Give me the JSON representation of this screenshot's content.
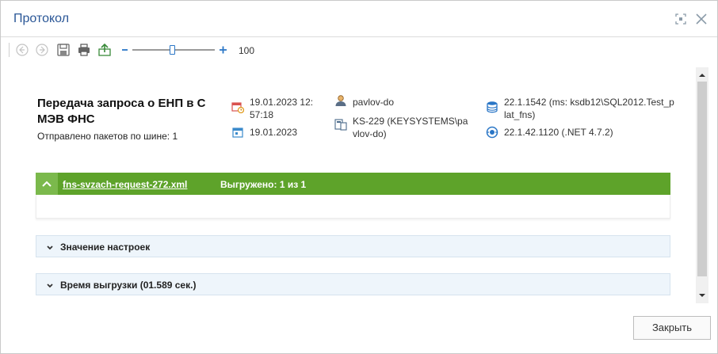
{
  "window": {
    "title": "Протокол"
  },
  "toolbar": {
    "zoom_value": "100",
    "zoom_level_fraction": 0.5
  },
  "header": {
    "title": "Передача запроса о ЕНП в С МЭВ ФНС",
    "subtitle": "Отправлено пакетов по шине: 1",
    "datetime_start": "19.01.2023 12:57:18",
    "date_end": "19.01.2023",
    "user": "pavlov-do",
    "machine": "KS-229 (KEYSYSTEMS\\pavlov-do)",
    "db": "22.1.1542 (ms: ksdb12\\SQL2012.Test_plat_fns)",
    "runtime": "22.1.42.1120 (.NET 4.7.2)"
  },
  "export_block": {
    "file": "fns-svzach-request-272.xml",
    "status": "Выгружено: 1 из 1"
  },
  "sections": [
    {
      "label": "Значение настроек"
    },
    {
      "label": "Время выгрузки (01.589 сек.)"
    }
  ],
  "footer": {
    "close_label": "Закрыть"
  },
  "colors": {
    "accent_green": "#5ea32a",
    "title_blue": "#2b5797",
    "section_bg": "#eef5fb"
  }
}
